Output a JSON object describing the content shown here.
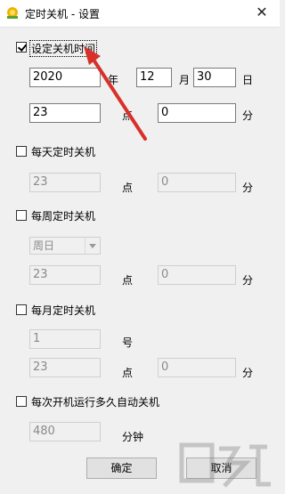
{
  "window": {
    "title": "定时关机 - 设置",
    "close_glyph": "✕"
  },
  "set_time": {
    "label": "设定关机时间",
    "checked": true,
    "year": "2020",
    "year_unit": "年",
    "month": "12",
    "month_unit": "月",
    "day": "30",
    "day_unit": "日",
    "hour": "23",
    "hour_unit": "点",
    "minute": "0",
    "minute_unit": "分"
  },
  "daily": {
    "label": "每天定时关机",
    "checked": false,
    "hour": "23",
    "hour_unit": "点",
    "minute": "0",
    "minute_unit": "分"
  },
  "weekly": {
    "label": "每周定时关机",
    "checked": false,
    "weekday": "周日",
    "hour": "23",
    "hour_unit": "点",
    "minute": "0",
    "minute_unit": "分"
  },
  "monthly": {
    "label": "每月定时关机",
    "checked": false,
    "date": "1",
    "date_unit": "号",
    "hour": "23",
    "hour_unit": "点",
    "minute": "0",
    "minute_unit": "分"
  },
  "after_boot": {
    "label": "每次开机运行多久自动关机",
    "checked": false,
    "minutes": "480",
    "minutes_unit": "分钟"
  },
  "buttons": {
    "ok": "确定",
    "cancel": "取消"
  },
  "colors": {
    "annotation_arrow": "#d9302a"
  }
}
